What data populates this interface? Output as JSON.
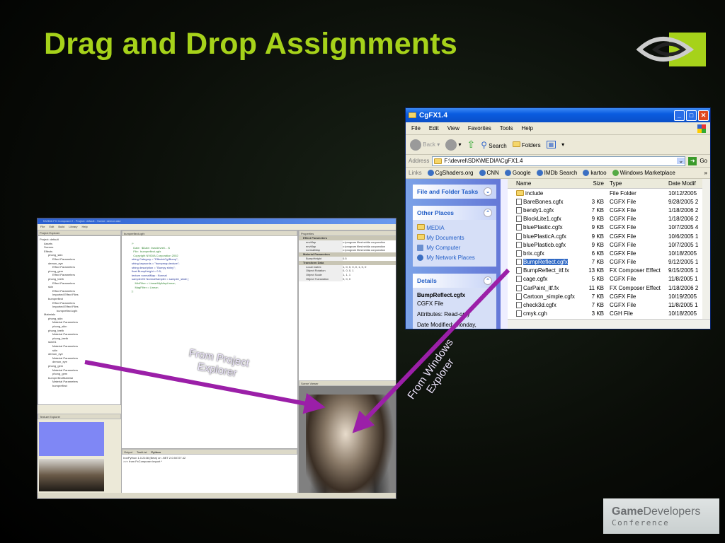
{
  "slide": {
    "title": "Drag and Drop Assignments",
    "accent": "#a6d21a",
    "arrow_color": "#9b1fa8",
    "arrow_labels": {
      "project": "From Project Explorer",
      "windows": "From Windows Explorer"
    },
    "gdc_logo": {
      "game": "Game",
      "developers": "Developers",
      "conference": "Conference"
    }
  },
  "explorer": {
    "title": "CgFX1.4",
    "menu": [
      "File",
      "Edit",
      "View",
      "Favorites",
      "Tools",
      "Help"
    ],
    "toolbar": {
      "back": "Back",
      "search": "Search",
      "folders": "Folders"
    },
    "address_label": "Address",
    "address": "F:\\devrel\\SDK\\MEDIA\\CgFX1.4",
    "go": "Go",
    "links_label": "Links",
    "links": [
      "CgShaders.org",
      "CNN",
      "Google",
      "IMDb Search",
      "kartoo",
      "Windows Marketplace"
    ],
    "tasks": {
      "file_folder": "File and Folder Tasks",
      "other_places": "Other Places",
      "places": [
        "MEDIA",
        "My Documents",
        "My Computer",
        "My Network Places"
      ],
      "details": "Details",
      "detail_name": "BumpReflect.cgfx",
      "detail_type": "CGFX File",
      "detail_attr": "Attributes: Read-only",
      "detail_date": "Date Modified: Monday,"
    },
    "columns": [
      "Name",
      "Size",
      "Type",
      "Date Modif"
    ],
    "files": [
      {
        "name": "include",
        "size": "",
        "type": "File Folder",
        "date": "10/12/2005"
      },
      {
        "name": "BareBones.cgfx",
        "size": "3 KB",
        "type": "CGFX File",
        "date": "9/28/2005 2"
      },
      {
        "name": "bendy1.cgfx",
        "size": "7 KB",
        "type": "CGFX File",
        "date": "1/18/2006 2"
      },
      {
        "name": "BlockLite1.cgfx",
        "size": "9 KB",
        "type": "CGFX File",
        "date": "1/18/2006 2"
      },
      {
        "name": "bluePlastic.cgfx",
        "size": "9 KB",
        "type": "CGFX File",
        "date": "10/7/2005 4"
      },
      {
        "name": "bluePlasticA.cgfx",
        "size": "9 KB",
        "type": "CGFX File",
        "date": "10/6/2005 1"
      },
      {
        "name": "bluePlasticb.cgfx",
        "size": "9 KB",
        "type": "CGFX File",
        "date": "10/7/2005 1"
      },
      {
        "name": "brix.cgfx",
        "size": "6 KB",
        "type": "CGFX File",
        "date": "10/18/2005"
      },
      {
        "name": "BumpReflect.cgfx",
        "size": "7 KB",
        "type": "CGFX File",
        "date": "9/12/2005 1",
        "selected": true
      },
      {
        "name": "BumpReflect_itf.fx",
        "size": "13 KB",
        "type": "FX Composer Effect",
        "date": "9/15/2005 1"
      },
      {
        "name": "cage.cgfx",
        "size": "5 KB",
        "type": "CGFX File",
        "date": "11/8/2005 1"
      },
      {
        "name": "CarPaint_itf.fx",
        "size": "11 KB",
        "type": "FX Composer Effect",
        "date": "1/18/2006 2"
      },
      {
        "name": "Cartoon_simple.cgfx",
        "size": "7 KB",
        "type": "CGFX File",
        "date": "10/19/2005"
      },
      {
        "name": "check3d.cgfx",
        "size": "7 KB",
        "type": "CGFX File",
        "date": "11/8/2005 1"
      },
      {
        "name": "cmyk.cgh",
        "size": "3 KB",
        "type": "CGH File",
        "date": "10/18/2005"
      }
    ]
  },
  "fx": {
    "title": "NVIDIA FX Composer 2 - Project: default - Scene: demon.dae",
    "menu": [
      "File",
      "Edit",
      "Build",
      "Library",
      "Help"
    ],
    "project_explorer": "Project Explorer",
    "texture_explorer": "Texture Explorer",
    "properties": "Properties",
    "scene_viewer": "Scene Viewer",
    "editor_tab": "bumpreflect.cgfx",
    "tree": [
      "Project: default",
      "Assets",
      "Scenes",
      "Effects",
      "phong_skin",
      "Effect Parameters",
      "demon_eye",
      "Effect Parameters",
      "phong_gem",
      "Effect Parameters",
      "phong_teeth",
      "Effect Parameters",
      "skin",
      "Effect Parameters",
      "Imported Effect Files",
      "bumpreflect",
      "Effect Parameters",
      "Imported Effect Files",
      "bumpreflect.cgfx",
      "Materials",
      "phong_skin",
      "Material Parameters",
      "phong_skin",
      "phong_teeth",
      "Material Parameters",
      "phong_teeth",
      "skin01",
      "Material Parameters",
      "skin",
      "demon_eye",
      "Material Parameters",
      "demon_eye",
      "phong_gem",
      "Material Parameters",
      "phong_gem",
      "bumpreflectMaterial",
      "Material Parameters",
      "bumpreflect"
    ],
    "code": [
      "/*",
      "  Date:  $Date: //sw/devrel/... $",
      "  File:  bumpreflect.cgfx",
      "",
      "  Copyright NVIDIA Corporation 2002",
      "",
      "string Category = \"Effects\\Cg\\Bump\";",
      "string keywords = \"bumpmap,texture\";",
      "string description = \"Bumpy shiny\";",
      "",
      "float BumpHeight = 0.5;",
      "",
      "texture normalMap : Normal",
      "sampler2D NormalSampler = sampler_state {",
      "    MinFilter = LinearMipMapLinear;",
      "    MagFilter = Linear;",
      "};"
    ],
    "output_tabs": [
      "Output",
      "TaskList",
      "Python"
    ],
    "output": [
      "IronPython 1.0.2108 (Beta) on .NET 2.0.50727.42",
      ">>> from FxComposer import *"
    ],
    "prop_sections": [
      "Effect Parameters",
      "Material Parameters",
      "Transform Data"
    ],
    "props": [
      [
        "envMap",
        "c:\\program files\\nvidia corporation"
      ],
      [
        "envMap",
        "c:\\program files\\nvidia corporation"
      ],
      [
        "normalMap",
        "c:\\program files\\nvidia corporation"
      ],
      [
        "BumpHeight",
        "0.5"
      ],
      [
        "Local matrix",
        "1, 0, 0, 0, 0, 1, 0, 0"
      ],
      [
        "Object Rotation",
        "0, 0, 0, 1"
      ],
      [
        "Object Scale",
        "1, 1, 1"
      ],
      [
        "Object Translation",
        "0, 0, 0"
      ]
    ]
  }
}
